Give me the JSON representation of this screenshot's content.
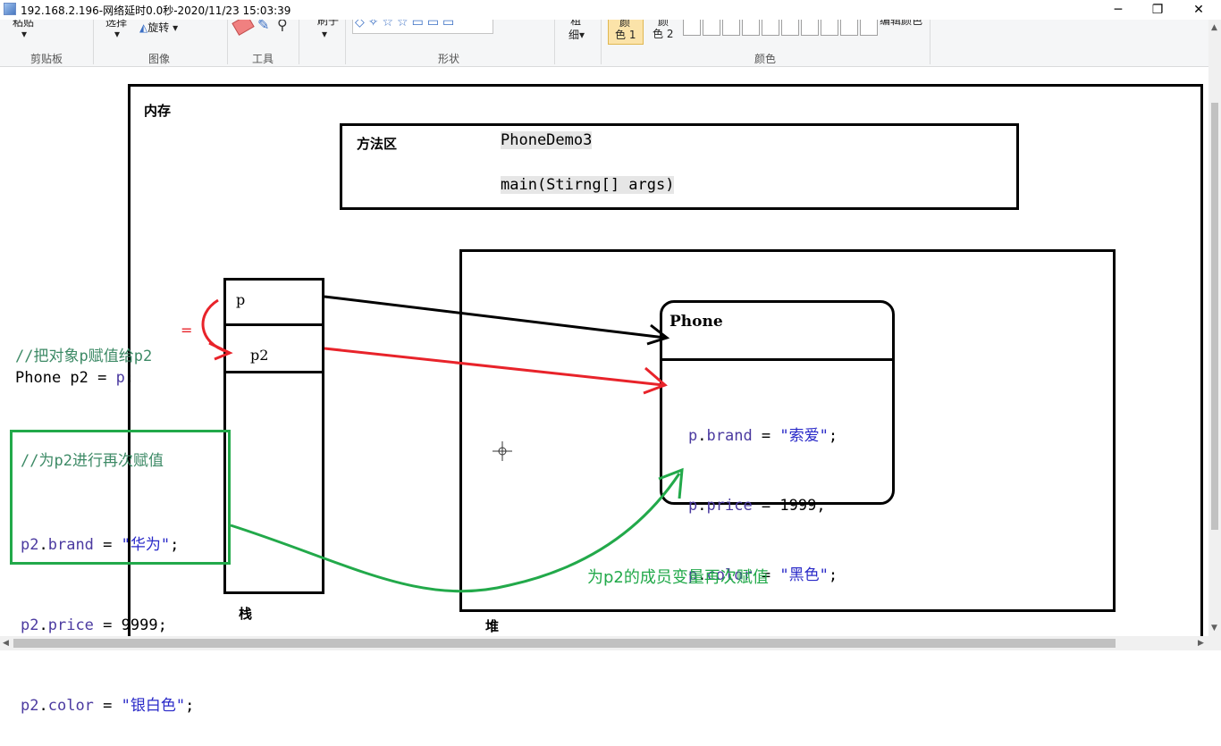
{
  "window": {
    "title": "192.168.2.196-网络延时0.0秒-2020/11/23 15:03:39",
    "controls": [
      "─",
      "❐",
      "✕"
    ]
  },
  "ribbon": {
    "groups": [
      "剪贴板",
      "图像",
      "工具",
      "形状",
      "颜色"
    ],
    "rotate_label": "旋转",
    "size_label": "粗",
    "size_label2": "细",
    "color1_label": "颜",
    "color1_label2": "色 1",
    "color2_label": "颜",
    "color2_label2": "色 2"
  },
  "drawing": {
    "memory_label": "内存",
    "method_area": {
      "label": "方法区",
      "class_name": "PhoneDemo3",
      "method": "main(Stirng[] args)"
    },
    "stack": {
      "label": "栈",
      "slot1": "p",
      "slot2": "p2"
    },
    "heap": {
      "label": "堆",
      "object_title": "Phone",
      "fields": [
        {
          "var": "p",
          "prop": "brand",
          "op": " = ",
          "value": "\"索爱\"",
          "end": ";"
        },
        {
          "var": "p",
          "prop": "price",
          "op": " = ",
          "value": "1999",
          "end": ";"
        },
        {
          "var": "p",
          "prop": "color",
          "op": " = ",
          "value": "\"黑色\"",
          "end": ";"
        }
      ]
    },
    "assign_comment": "//把对象p赋值给p2",
    "assign_code_a": "Phone p2 = ",
    "assign_code_b": "p",
    "assign_code_c": ";",
    "equals_mark": "=",
    "reassign": {
      "comment": "//为p2进行再次赋值",
      "lines": [
        {
          "var": "p2",
          "prop": "brand",
          "op": " = ",
          "value": "\"华为\"",
          "end": ";"
        },
        {
          "var": "p2",
          "prop": "price",
          "op": " = ",
          "value": "9999",
          "end": ";"
        },
        {
          "var": "p2",
          "prop": "color",
          "op": " = ",
          "value": "\"银白色\"",
          "end": ";"
        }
      ]
    },
    "green_note": "为p2的成员变量再次赋值"
  },
  "colors": {
    "red": "#e8232a",
    "green": "#22a94a",
    "black": "#000000"
  }
}
